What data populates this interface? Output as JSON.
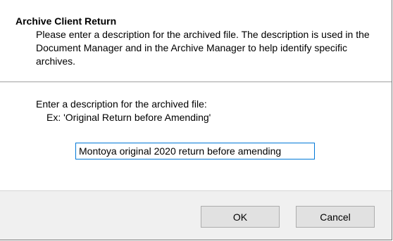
{
  "dialog": {
    "title": "Archive Client Return",
    "description": "Please enter a description for the archived file. The description is used in the Document Manager and in the Archive Manager to help identify specific archives.",
    "prompt_label": "Enter a description for the archived file:",
    "example_label": "Ex: 'Original Return before Amending'",
    "input_value": "Montoya original 2020 return before amending",
    "ok_label": "OK",
    "cancel_label": "Cancel"
  },
  "colors": {
    "input_border": "#0078d7",
    "footer_background": "#f0f0f0",
    "button_background": "#e1e1e1"
  }
}
